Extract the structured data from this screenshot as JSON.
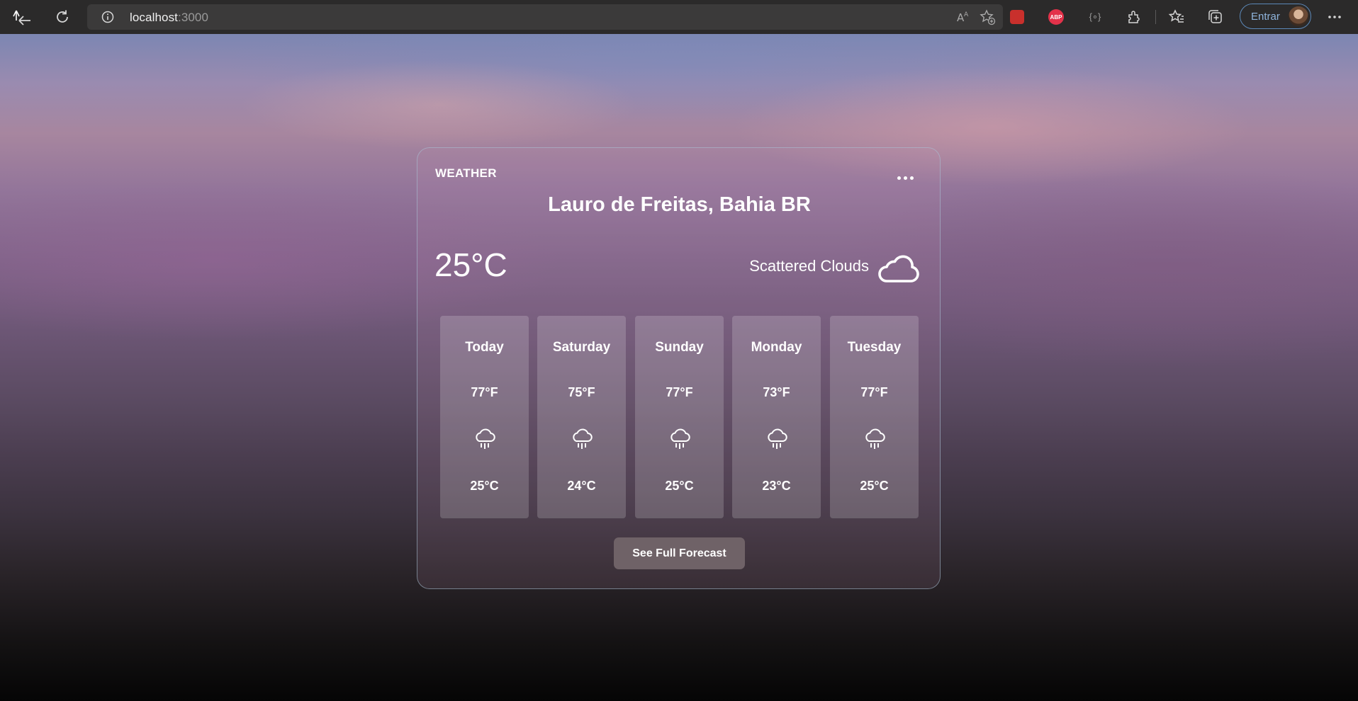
{
  "browser": {
    "url_host": "localhost",
    "url_port": ":3000",
    "signin_label": "Entrar",
    "extensions": [
      "record-extension-icon",
      "adblock-plus-icon",
      "code-extension-icon"
    ],
    "abp_text": "ABP",
    "ext3_text": "{∘}"
  },
  "weather": {
    "brand": "WEATHER",
    "location": "Lauro de Freitas, Bahia BR",
    "current_temp": "25°C",
    "condition": "Scattered Clouds",
    "forecast": [
      {
        "day": "Today",
        "high": "77°F",
        "low": "25°C"
      },
      {
        "day": "Saturday",
        "high": "75°F",
        "low": "24°C"
      },
      {
        "day": "Sunday",
        "high": "77°F",
        "low": "25°C"
      },
      {
        "day": "Monday",
        "high": "73°F",
        "low": "23°C"
      },
      {
        "day": "Tuesday",
        "high": "77°F",
        "low": "25°C"
      }
    ],
    "cta_label": "See Full Forecast"
  },
  "colors": {
    "chrome_bg": "#2b2a2a",
    "address_bg": "#3b3a3a",
    "signin_border": "#5c88b8",
    "card_border": "#aac3d7",
    "cta_bg": "#6f6267"
  }
}
